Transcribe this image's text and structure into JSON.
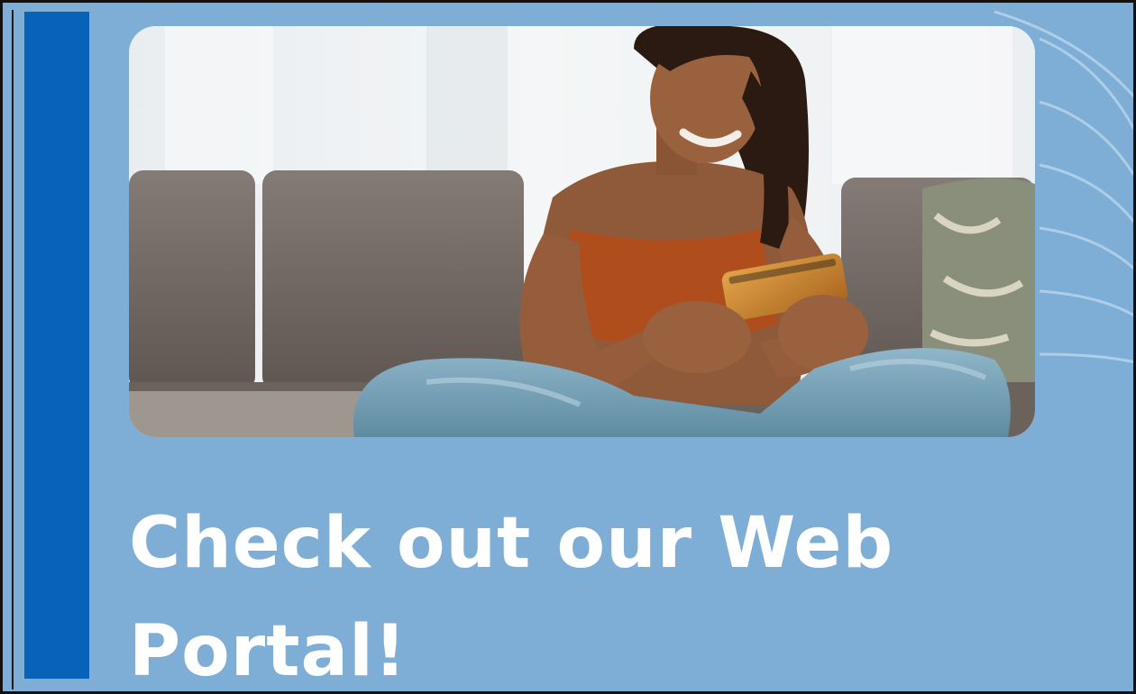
{
  "banner": {
    "headline_line1": "Check out our Web",
    "headline_line2": "Portal!"
  },
  "colors": {
    "background": "#7eaed6",
    "accent_bar": "#0762b8",
    "headline_text": "#ffffff",
    "frame_border": "#111111"
  },
  "photo": {
    "icon": "woman-smartphone-photo"
  }
}
